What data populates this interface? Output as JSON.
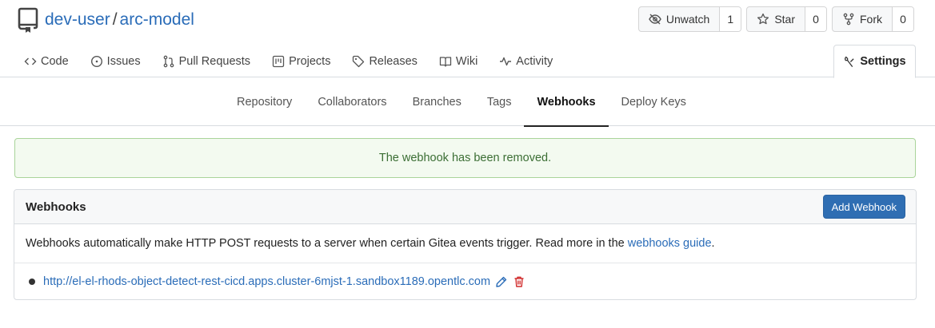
{
  "repo": {
    "owner": "dev-user",
    "separator": "/",
    "name": "arc-model",
    "icon": "repo-icon"
  },
  "actions": {
    "watch": {
      "label": "Unwatch",
      "count": "1",
      "icon": "eye-slash-icon"
    },
    "star": {
      "label": "Star",
      "count": "0",
      "icon": "star-icon"
    },
    "fork": {
      "label": "Fork",
      "count": "0",
      "icon": "fork-icon"
    }
  },
  "tabs": [
    {
      "label": "Code",
      "icon": "code-icon"
    },
    {
      "label": "Issues",
      "icon": "issue-opened-icon"
    },
    {
      "label": "Pull Requests",
      "icon": "pull-request-icon"
    },
    {
      "label": "Projects",
      "icon": "project-icon"
    },
    {
      "label": "Releases",
      "icon": "tag-icon"
    },
    {
      "label": "Wiki",
      "icon": "book-icon"
    },
    {
      "label": "Activity",
      "icon": "pulse-icon"
    }
  ],
  "settings_tab": {
    "label": "Settings",
    "icon": "tools-icon"
  },
  "settings_nav": [
    {
      "label": "Repository"
    },
    {
      "label": "Collaborators"
    },
    {
      "label": "Branches"
    },
    {
      "label": "Tags"
    },
    {
      "label": "Webhooks",
      "active": true
    },
    {
      "label": "Deploy Keys"
    }
  ],
  "flash": {
    "message": "The webhook has been removed.",
    "color": "#f3faf0"
  },
  "webhooks": {
    "title": "Webhooks",
    "add_button": "Add Webhook",
    "description": "Webhooks automatically make HTTP POST requests to a server when certain Gitea events trigger. Read more in the",
    "guide_link": "webhooks guide",
    "guide_suffix": ".",
    "items": [
      {
        "url": "http://el-el-rhods-object-detect-rest-cicd.apps.cluster-6mjst-1.sandbox1189.opentlc.com",
        "edit_icon": "pencil-icon",
        "delete_icon": "trash-icon"
      }
    ]
  },
  "colors": {
    "accent": "#2a6cb8",
    "primary_button": "#2f6eb3",
    "delete": "#d12c2c",
    "success_text": "#3b6e34"
  }
}
